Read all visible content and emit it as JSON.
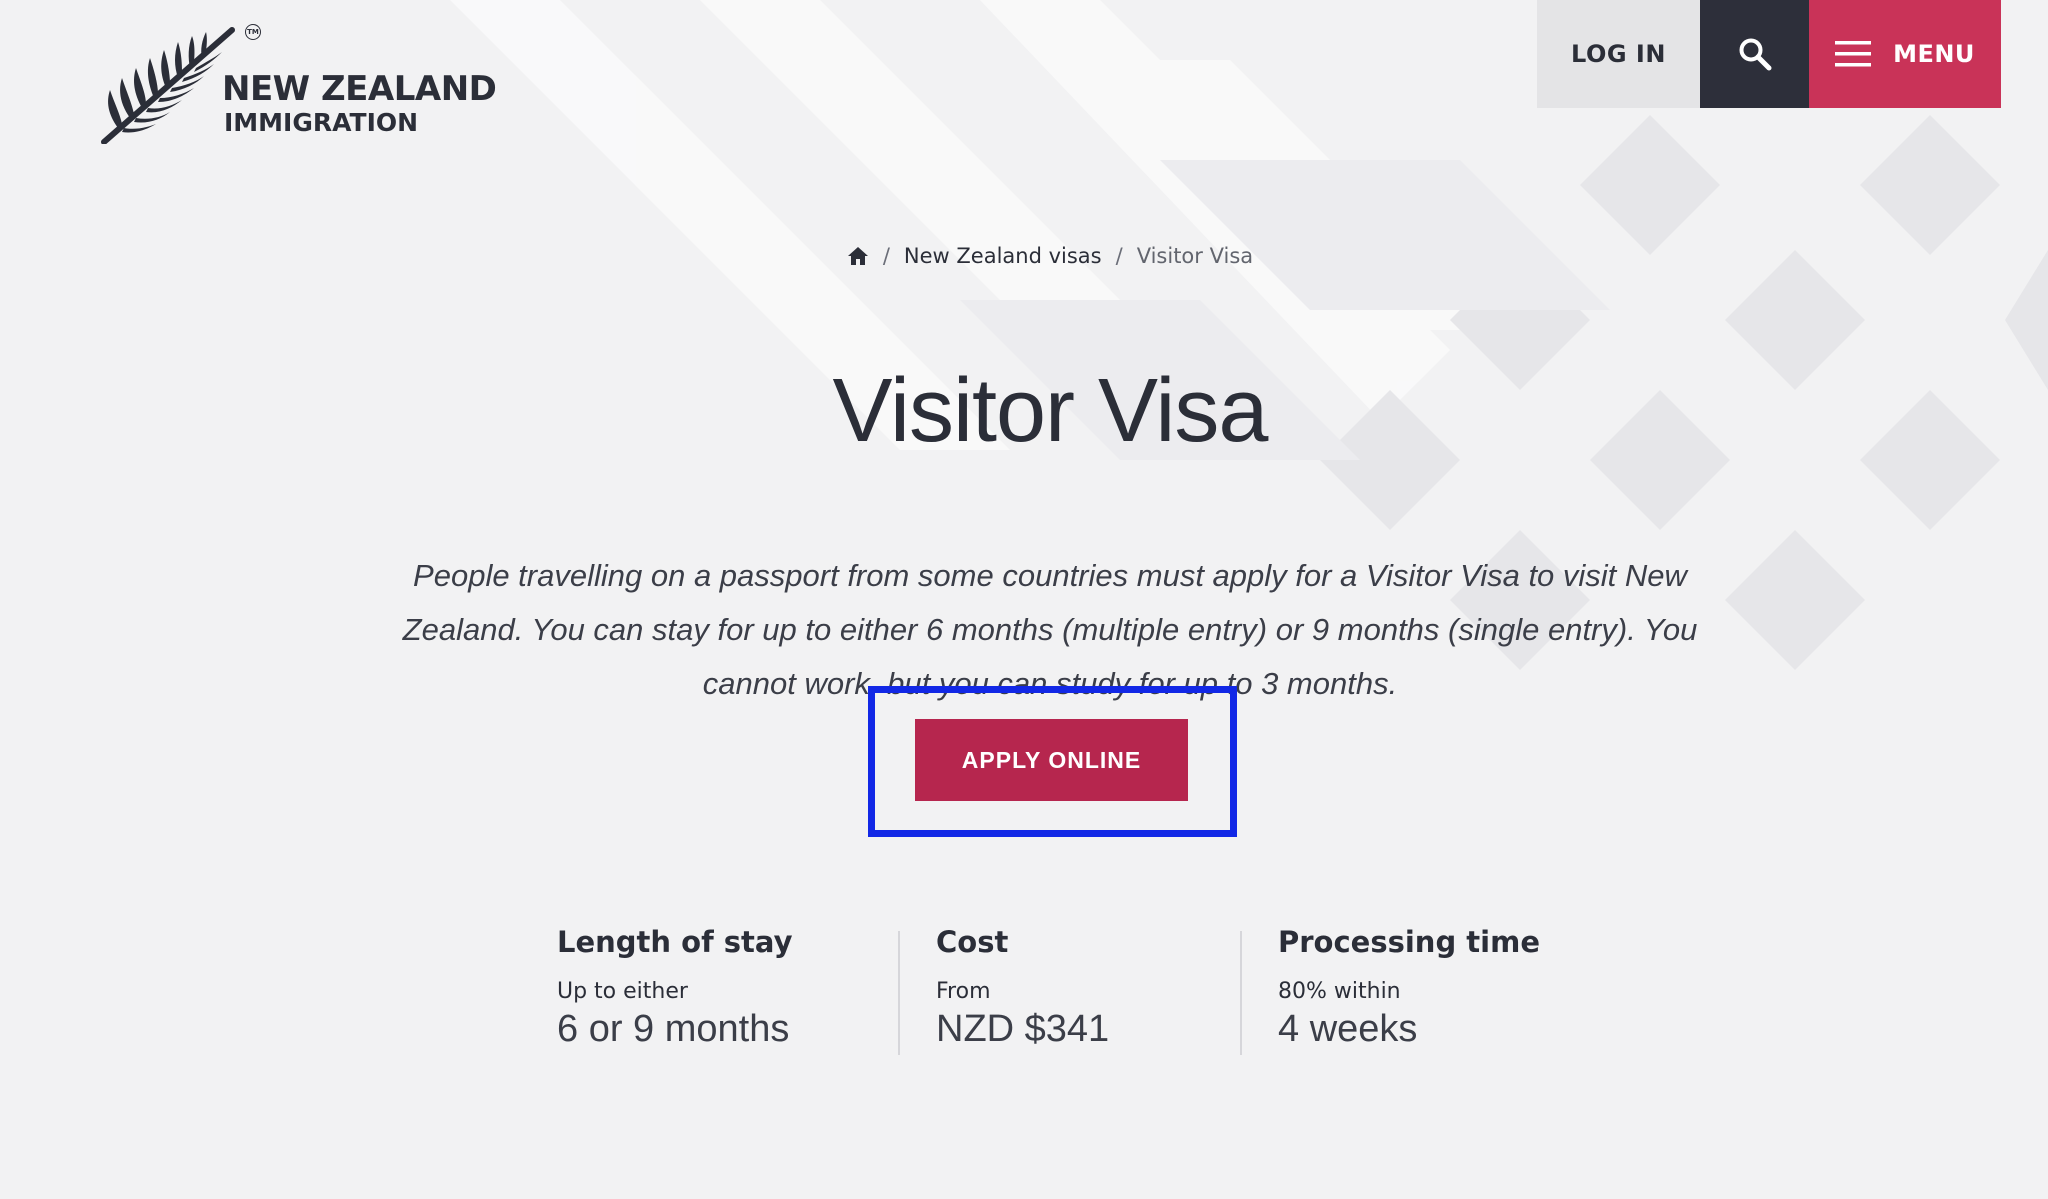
{
  "brand": {
    "line1": "NEW ZEALAND",
    "line2": "IMMIGRATION",
    "tm": "TM"
  },
  "nav": {
    "login_label": "LOG IN",
    "search_icon": "search-icon",
    "menu_label": "MENU",
    "menu_icon": "hamburger-icon"
  },
  "breadcrumb": {
    "home_icon": "home-icon",
    "separator": "/",
    "items": [
      "New Zealand visas",
      "Visitor Visa"
    ]
  },
  "page": {
    "title": "Visitor Visa",
    "intro": "People travelling on a passport from some countries must apply for a Visitor Visa to visit New Zealand. You can stay for up to either 6 months (multiple entry) or 9 months (single entry). You cannot work, but you can study for up to 3 months.",
    "apply_label": "APPLY ONLINE"
  },
  "facts": [
    {
      "label": "Length of stay",
      "sub": "Up to either",
      "value": "6 or 9 months"
    },
    {
      "label": "Cost",
      "sub": "From",
      "value": "NZD $341"
    },
    {
      "label": "Processing time",
      "sub": "80% within",
      "value": "4 weeks"
    }
  ],
  "colors": {
    "background": "#f2f2f3",
    "login_bg": "#e4e4e6",
    "search_bg": "#2d2f3a",
    "menu_bg": "#c93358",
    "apply_bg": "#b6264e",
    "highlight": "#1228e6",
    "text": "#2b2e38"
  }
}
